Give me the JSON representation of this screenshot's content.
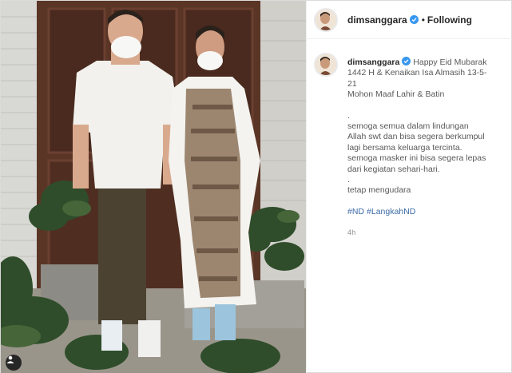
{
  "post": {
    "username": "dimsanggara",
    "follow_label": "Following",
    "dot": "•",
    "caption": {
      "lines": [
        "Happy Eid Mubarak",
        "1442 H & Kenaikan Isa Almasih 13-5-",
        "21",
        "Mohon Maaf Lahir & Batin"
      ],
      "spacer": ".",
      "body_lines": [
        "semoga semua dalam lindungan",
        "Allah swt dan bisa segera berkumpul",
        "lagi bersama keluarga tercinta.",
        "semoga masker ini bisa segera lepas",
        "dari kegiatan sehari-hari."
      ],
      "spacer2": ".",
      "closing": "tetap mengudara",
      "hashtags": [
        "#ND",
        "#LangkahND"
      ]
    },
    "time_ago": "4h"
  },
  "colors": {
    "verified": "#3897f0",
    "hashtag": "#3d6ba8",
    "text": "#262626",
    "muted": "#8e8e8e"
  },
  "icons": {
    "verified": "verified-badge-icon",
    "user": "user-tag-icon"
  }
}
